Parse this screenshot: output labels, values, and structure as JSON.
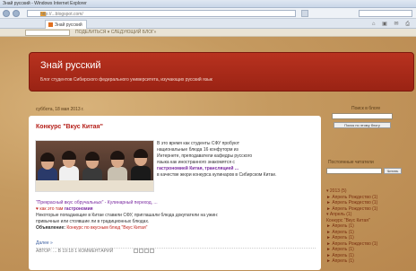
{
  "browser": {
    "window_title": "Знай русский - Windows Internet Explorer",
    "address": "http://...blogspot.com/",
    "tabs": [
      {
        "label": "Знай русский"
      }
    ],
    "toolbar_icons": "⌂ ▣ ✉ ⎙"
  },
  "blogger_nav": {
    "links": "ПОДЕЛИТЬСЯ ▾   СЛЕДУЮЩИЙ БЛОГ»"
  },
  "header": {
    "title": "Знай русский",
    "description": "Блог студентов Сибирского федерального университета, изучающих русский язык"
  },
  "post": {
    "date": "суббота, 18 мая 2013 г.",
    "title": "Конкурс \"Вкус Китая\"",
    "intro_lines": [
      "В это время как студенты СФУ пробуют",
      "национальные блюда 16 конфуторм из",
      "Интернете, преподаватели кафедры русского",
      "языка как иностранного знакомятся с"
    ],
    "intro_highlight": "гастрономией Китая, трансляцией ...",
    "intro_tail": "в качестве жюри конкурса кулинаров в Сибирском Китае.",
    "body_line1_purple": "\"Прекрасный вкус обручальных\" - Кулинарный переход, ...",
    "body_line2_prefix": "♥ как это там",
    "body_line2_red": "гастрономия",
    "body_line3": "Некоторые попадающие в Китае ставили СФУ, приглашали блюда докупатели на ужин:",
    "body_line4": "привычные или стоявшие ли в традиционных блюдах.",
    "body_line5_prefix": "Объявление:",
    "body_line5_red": "Конкурс по вкусным блюд \"Вкус Китая\"",
    "more": "Далее »",
    "footer_meta": "АВТОР: ... В 19:18   1 КОММЕНТАРИЙ"
  },
  "sidebar": {
    "search_title": "Поиск в блоге",
    "search_button": "Поиск по этому блогу",
    "followers_title": "Постоянные читатели",
    "follow_button": "Читать",
    "archive": [
      "▾ 2013 (5)",
      "  ► Апрель Рождество (1)",
      "  ► Апрель Рождество (1)",
      "  ► Апрель Рождество (1)",
      "  ▾ Апрель (1)",
      "    Конкурс \"Вкус Китая\"",
      "  ► Апрель (1)",
      "  ► Апрель (1)",
      "  ► Апрель (1)",
      "  ► Апрель Рождество (1)",
      "  ► Апрель (1)",
      "  ► Апрель (1)",
      "  ► Апрель (1)"
    ]
  },
  "colors": {
    "header_red": "#b8321f",
    "post_title_red": "#b5201a",
    "highlight_purple": "#7a2aa0",
    "page_background": "#c9a068"
  }
}
